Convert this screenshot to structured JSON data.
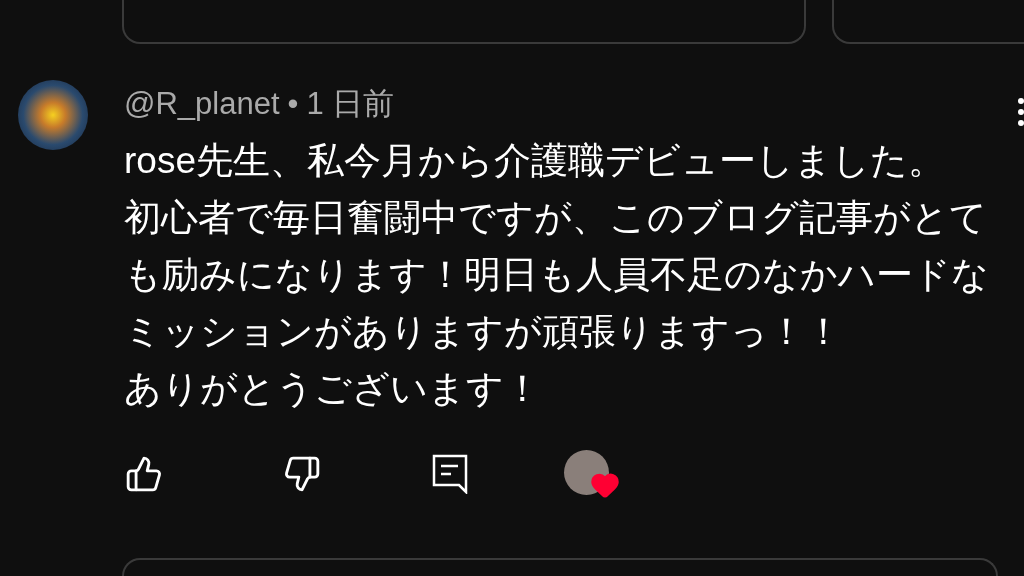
{
  "comment": {
    "author": "@R_planet",
    "separator": "•",
    "time": "1 日前",
    "lines": [
      "rose先生、私今月から介護職デビューしました。",
      "初心者で毎日奮闘中ですが、このブログ記事がとて",
      "も励みになります！明日も人員不足のなかハードな",
      "ミッションがありますが頑張りますっ！！",
      "ありがとうございます！"
    ],
    "hearted": true
  }
}
